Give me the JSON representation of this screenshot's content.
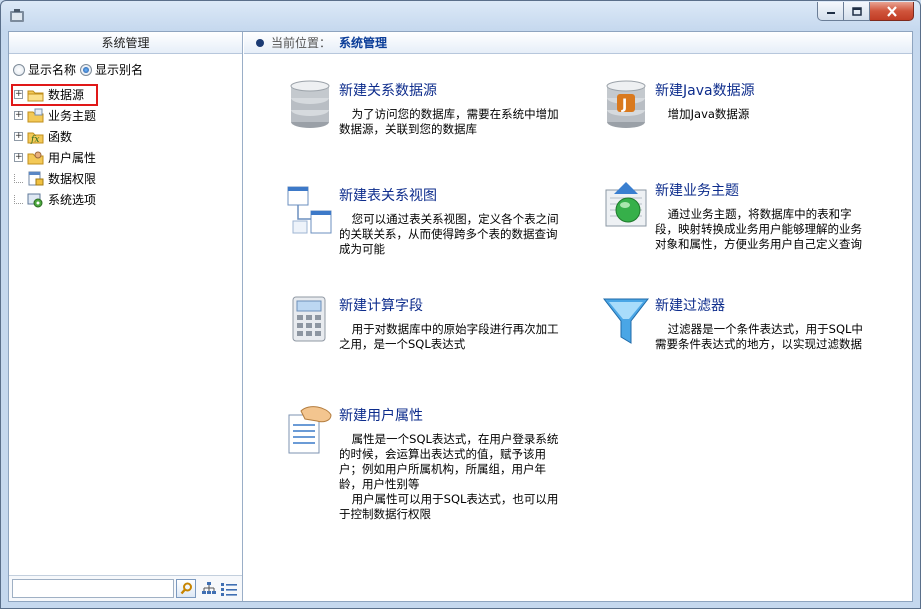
{
  "window": {
    "controls": [
      "minimize",
      "maximize",
      "close"
    ]
  },
  "left_panel": {
    "title": "系统管理",
    "radio_options": [
      {
        "label": "显示名称",
        "selected": false
      },
      {
        "label": "显示别名",
        "selected": true
      }
    ],
    "tree": [
      {
        "label": "数据源",
        "icon": "folder-icon",
        "expandable": true,
        "selected": true
      },
      {
        "label": "业务主题",
        "icon": "business-topic-icon",
        "expandable": true
      },
      {
        "label": "函数",
        "icon": "function-icon",
        "expandable": true
      },
      {
        "label": "用户属性",
        "icon": "user-property-icon",
        "expandable": true
      },
      {
        "label": "数据权限",
        "icon": "data-permission-icon",
        "expandable": false
      },
      {
        "label": "系统选项",
        "icon": "system-options-icon",
        "expandable": false
      }
    ],
    "search": {
      "placeholder": "",
      "value": ""
    }
  },
  "breadcrumb": {
    "label": "当前位置：",
    "current": "系统管理"
  },
  "cards": [
    {
      "title": "新建关系数据源",
      "icon": "database-icon",
      "desc": [
        "为了访问您的数据库，需要在系统中增加数据源，关联到您的数据库"
      ]
    },
    {
      "title": "新建Java数据源",
      "icon": "java-database-icon",
      "desc": [
        "增加Java数据源"
      ]
    },
    {
      "title": "新建表关系视图",
      "icon": "table-relation-icon",
      "desc": [
        "您可以通过表关系视图，定义各个表之间的关联关系，从而使得跨多个表的数据查询成为可能"
      ]
    },
    {
      "title": "新建业务主题",
      "icon": "business-topic-icon",
      "desc": [
        "通过业务主题，将数据库中的表和字段，映射转换成业务用户能够理解的业务对象和属性，方便业务用户自己定义查询"
      ]
    },
    {
      "title": "新建计算字段",
      "icon": "calculator-icon",
      "desc": [
        "用于对数据库中的原始字段进行再次加工之用，是一个SQL表达式"
      ]
    },
    {
      "title": "新建过滤器",
      "icon": "filter-icon",
      "desc": [
        "过滤器是一个条件表达式，用于SQL中需要条件表达式的地方，以实现过滤数据"
      ]
    },
    {
      "title": "新建用户属性",
      "icon": "user-property-icon",
      "desc": [
        "属性是一个SQL表达式，在用户登录系统的时候，会运算出表达式的值，赋予该用户；例如用户所属机构，所属组，用户年龄，用户性别等",
        "用户属性可以用于SQL表达式，也可以用于控制数据行权限"
      ]
    }
  ]
}
